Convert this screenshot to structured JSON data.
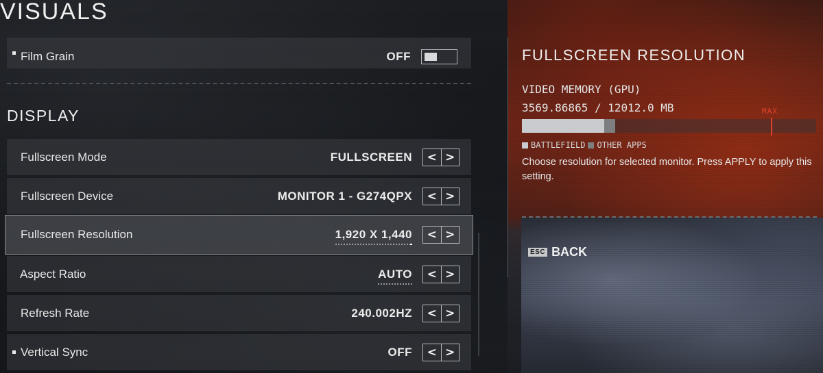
{
  "page": {
    "title": "VISUALS"
  },
  "sections": {
    "display_title": "DISPLAY"
  },
  "rows": {
    "film_grain": {
      "label": "Film Grain",
      "value": "OFF"
    },
    "fullscreen_mode": {
      "label": "Fullscreen Mode",
      "value": "FULLSCREEN"
    },
    "fullscreen_device": {
      "label": "Fullscreen Device",
      "value": "MONITOR 1 - G274QPX"
    },
    "fullscreen_resolution": {
      "label": "Fullscreen Resolution",
      "value": "1,920 X 1,440"
    },
    "aspect_ratio": {
      "label": "Aspect Ratio",
      "value": "AUTO"
    },
    "refresh_rate": {
      "label": "Refresh Rate",
      "value": "240.002HZ"
    },
    "vertical_sync": {
      "label": "Vertical Sync",
      "value": "OFF"
    }
  },
  "arrows": {
    "left": "<",
    "right": ">"
  },
  "panel": {
    "title": "FULLSCREEN RESOLUTION",
    "vm_label": "VIDEO MEMORY (GPU)",
    "vm_value": "3569.86865 / 12012.0 MB",
    "max_label": "MAX",
    "memory": {
      "battlefield_fraction": 0.28,
      "other_fraction": 0.036,
      "max_fraction": 0.845
    },
    "legend": {
      "battlefield": "BATTLEFIELD",
      "other_apps": "OTHER APPS"
    },
    "description": "Choose resolution for selected monitor. Press APPLY to apply this setting.",
    "esc_key": "ESC",
    "back_label": "BACK"
  },
  "colors": {
    "accent_red": "#e0402c",
    "battlefield_bar": "#c9cbce",
    "other_apps_bar": "#7d7e80"
  }
}
